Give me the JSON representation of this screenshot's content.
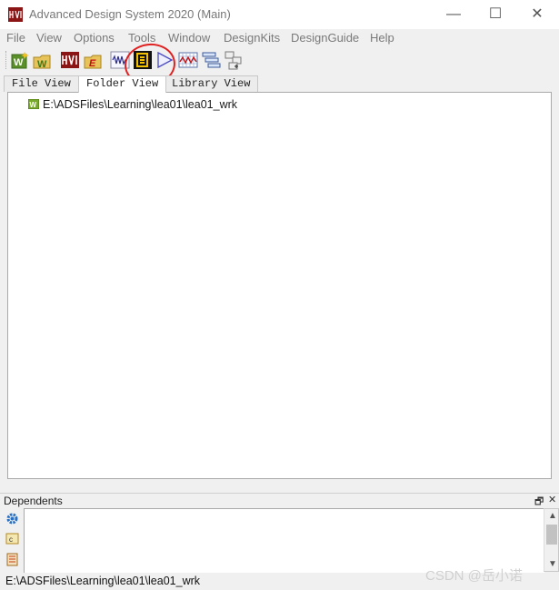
{
  "window": {
    "title": "Advanced Design System 2020 (Main)",
    "controls": {
      "minimize": "—",
      "maximize": "☐",
      "close": "✕"
    }
  },
  "menu": [
    "File",
    "View",
    "Options",
    "Tools",
    "Window",
    "DesignKits",
    "DesignGuide",
    "Help"
  ],
  "toolbar": {
    "buttons": [
      {
        "name": "new-workspace-icon"
      },
      {
        "name": "open-workspace-icon"
      },
      {
        "name": "ads-logo-icon"
      },
      {
        "name": "example-project-icon"
      },
      {
        "name": "new-schematic-icon"
      },
      {
        "name": "new-symbol-icon"
      },
      {
        "name": "amplifier-icon"
      },
      {
        "name": "data-display-icon"
      },
      {
        "name": "library-list-icon"
      },
      {
        "name": "hierarchy-icon"
      }
    ],
    "annotation_color": "#e02020"
  },
  "tabs": [
    {
      "label": "File View",
      "active": false
    },
    {
      "label": "Folder View",
      "active": true
    },
    {
      "label": "Library View",
      "active": false
    }
  ],
  "tree": {
    "items": [
      {
        "label": "E:\\ADSFiles\\Learning\\lea01\\lea01_wrk",
        "icon": "workspace-icon"
      }
    ]
  },
  "dependents": {
    "title": "Dependents",
    "controls": {
      "float": "🗗",
      "close": "✕"
    },
    "side_icons": [
      "gear-icon",
      "cell-icon",
      "library-icon"
    ]
  },
  "status": {
    "path": "E:\\ADSFiles\\Learning\\lea01\\lea01_wrk"
  },
  "watermark": "CSDN @岳小诺",
  "colors": {
    "brand": "#8b1414",
    "tree_icon": "#7aa82c",
    "circle": "#e02020"
  }
}
